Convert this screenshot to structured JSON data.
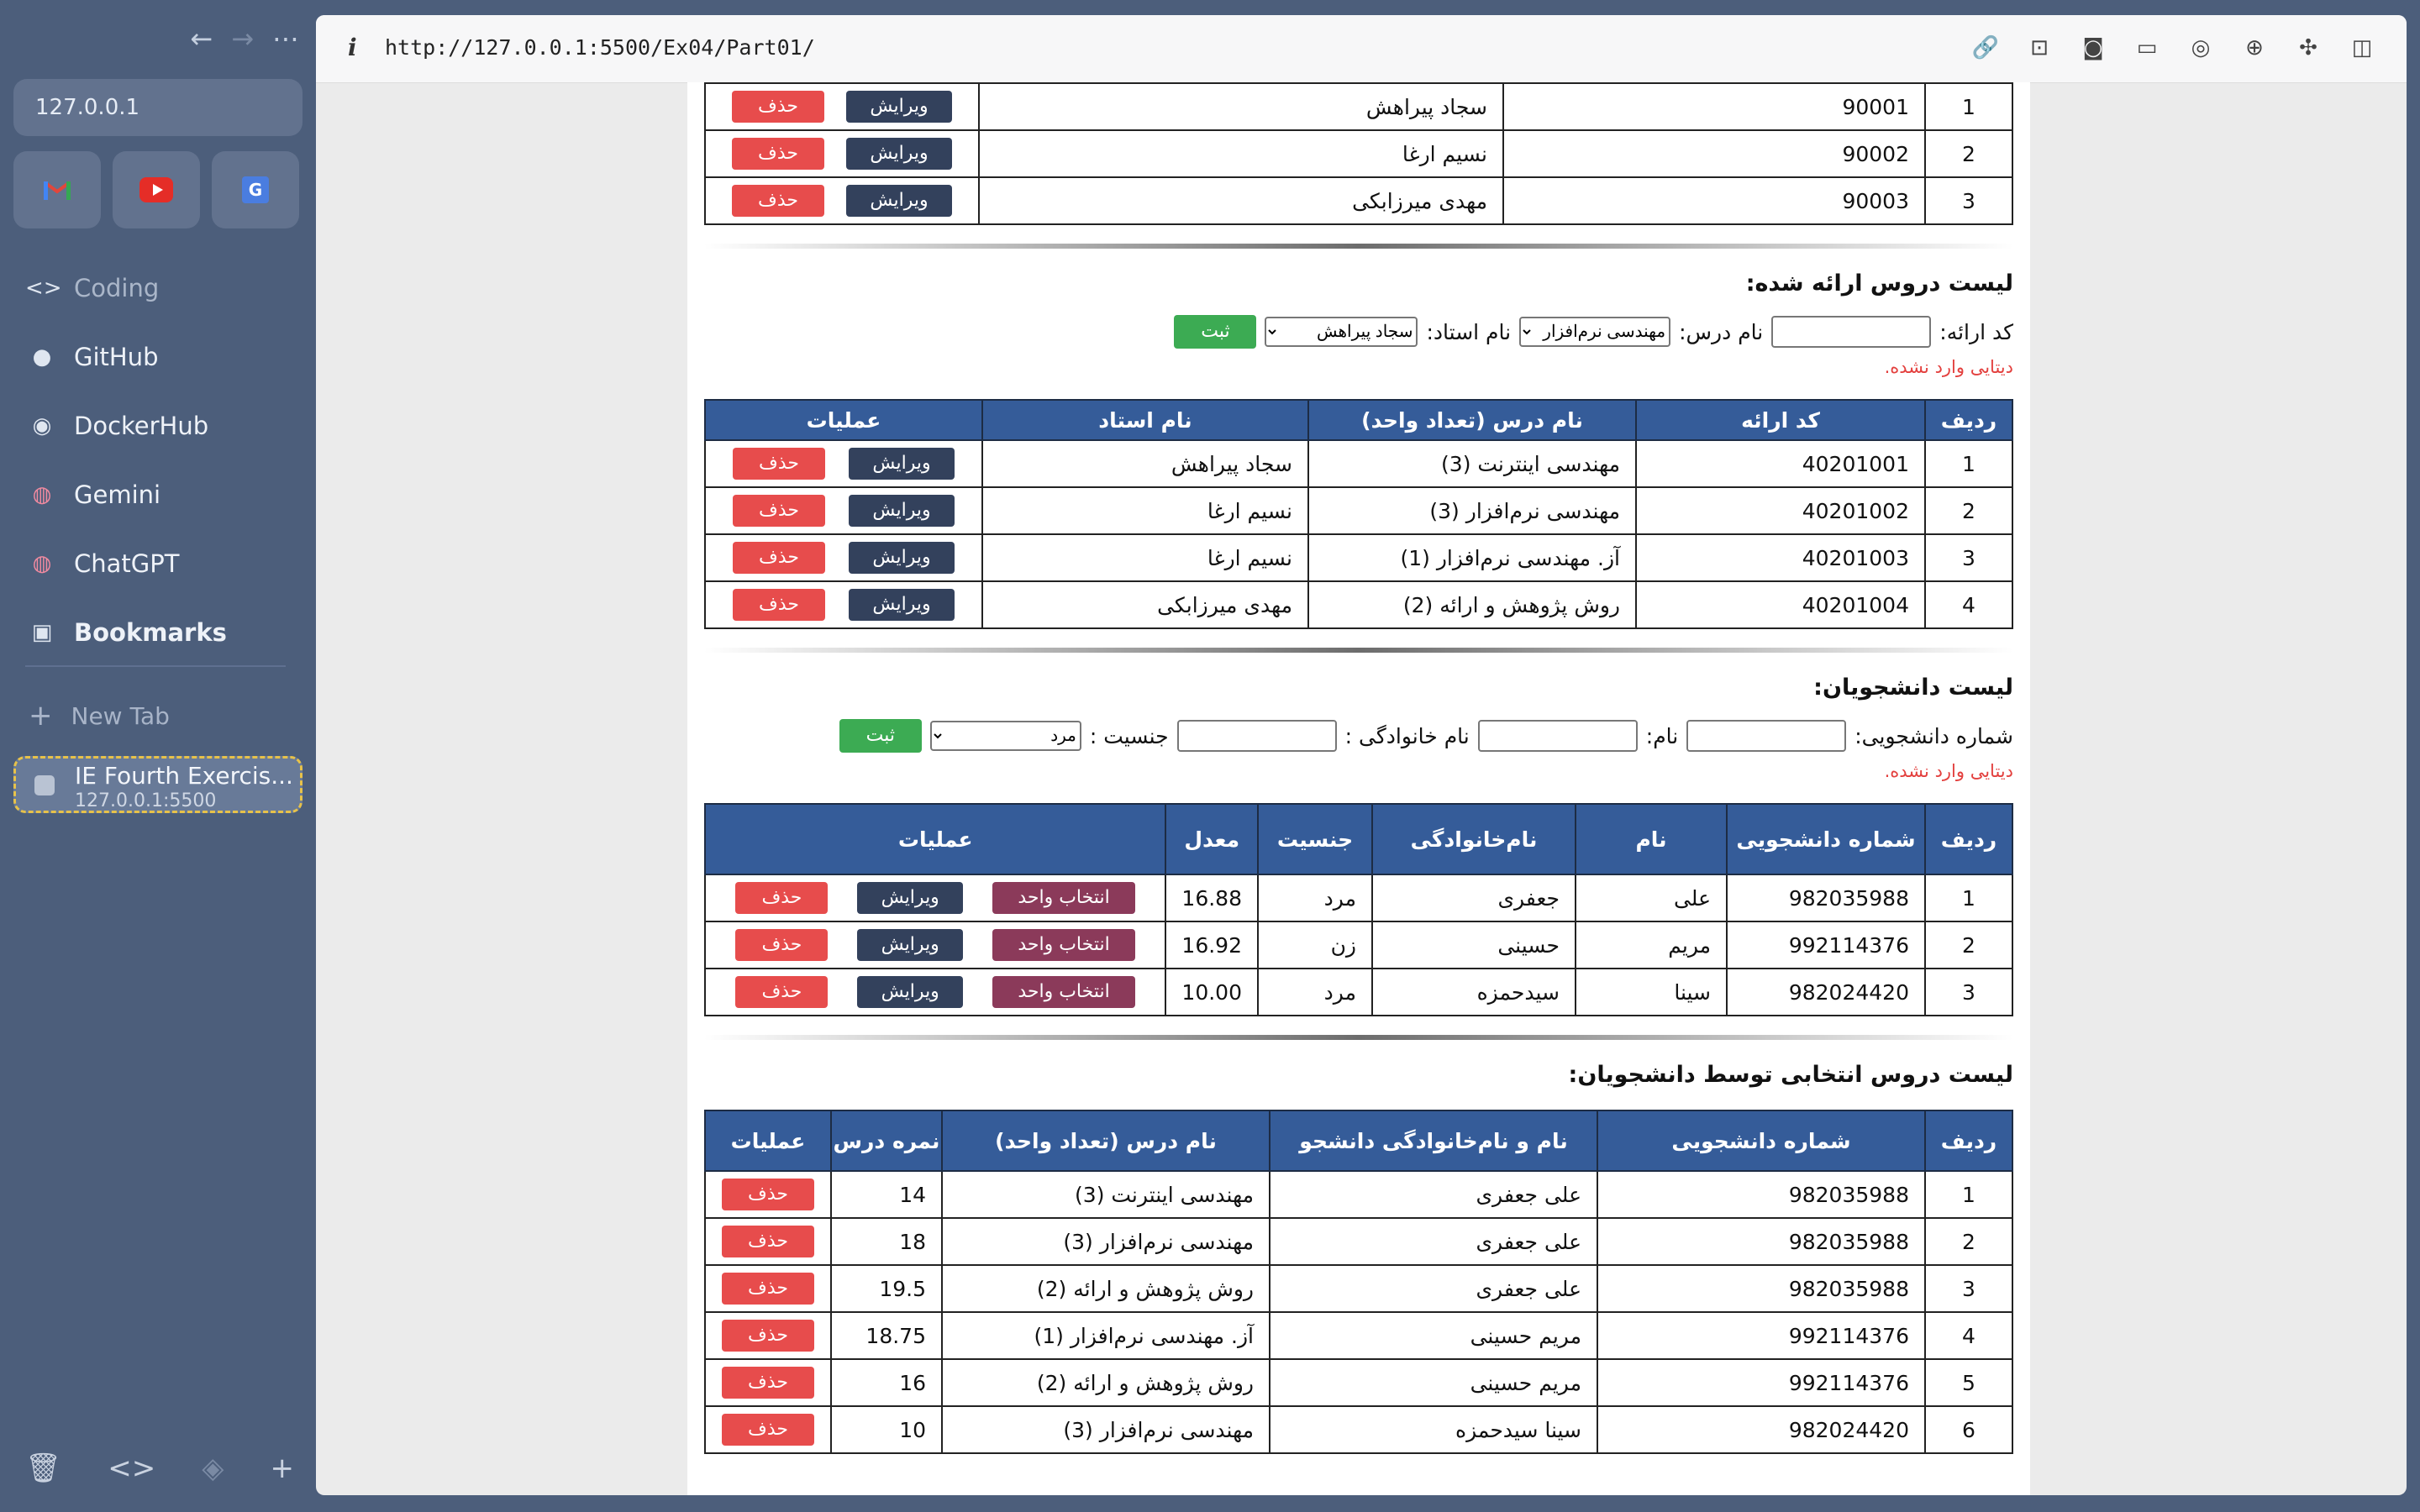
{
  "sidebar": {
    "url_box": "127.0.0.1",
    "items": [
      {
        "label": "Coding",
        "icon": "code-icon"
      },
      {
        "label": "GitHub",
        "icon": "github-icon"
      },
      {
        "label": "DockerHub",
        "icon": "docker-icon"
      },
      {
        "label": "Gemini",
        "icon": "brain-icon"
      },
      {
        "label": "ChatGPT",
        "icon": "brain-icon"
      },
      {
        "label": "Bookmarks",
        "icon": "folder-icon"
      }
    ],
    "new_tab": "New Tab",
    "active_tab": {
      "title": "IE Fourth Exercis...",
      "subtitle": "127.0.0.1:5500"
    }
  },
  "browser": {
    "url": "http://127.0.0.1:5500/Ex04/Part01/"
  },
  "buttons": {
    "delete": "حذف",
    "edit": "ویرایش",
    "pick": "انتخاب واحد",
    "save": "ثبت"
  },
  "professors_table": {
    "rows": [
      {
        "idx": "1",
        "code": "90001",
        "name": "سجاد پیراهش"
      },
      {
        "idx": "2",
        "code": "90002",
        "name": "نسیم ارغا"
      },
      {
        "idx": "3",
        "code": "90003",
        "name": "مهدی میرزابکی"
      }
    ]
  },
  "offered": {
    "title": "لیست دروس ارائه شده:",
    "form": {
      "code_label": "کد ارائه:",
      "course_label": "نام درس:",
      "course_value": "مهندسی نرم‌افزار",
      "prof_label": "نام استاد:",
      "prof_value": "سجاد پیراهش"
    },
    "error": "دیتایی وارد نشده.",
    "headers": {
      "idx": "ردیف",
      "code": "کد ارائه",
      "course": "نام درس (تعداد واحد)",
      "prof": "نام استاد",
      "ops": "عملیات"
    },
    "rows": [
      {
        "idx": "1",
        "code": "40201001",
        "course": "مهندسی اینترنت (3)",
        "prof": "سجاد پیراهش"
      },
      {
        "idx": "2",
        "code": "40201002",
        "course": "مهندسی نرم‌افزار (3)",
        "prof": "نسیم ارغا"
      },
      {
        "idx": "3",
        "code": "40201003",
        "course": "آز. مهندسی نرم‌افزار (1)",
        "prof": "نسیم ارغا"
      },
      {
        "idx": "4",
        "code": "40201004",
        "course": "روش پژوهش و ارائه (2)",
        "prof": "مهدی میرزابکی"
      }
    ]
  },
  "students": {
    "title": "لیست دانشجویان:",
    "form": {
      "id_label": "شماره دانشجویی:",
      "first_label": "نام:",
      "last_label": "نام خانوادگی :",
      "gender_label": "جنسیت :",
      "gender_value": "مرد"
    },
    "error": "دیتایی وارد نشده.",
    "headers": {
      "idx": "ردیف",
      "sid": "شماره دانشجویی",
      "first": "نام",
      "last": "نام‌خانوادگی",
      "gender": "جنسیت",
      "gpa": "معدل",
      "ops": "عملیات"
    },
    "rows": [
      {
        "idx": "1",
        "sid": "982035988",
        "first": "علی",
        "last": "جعفری",
        "gender": "مرد",
        "gpa": "16.88"
      },
      {
        "idx": "2",
        "sid": "992114376",
        "first": "مریم",
        "last": "حسینی",
        "gender": "زن",
        "gpa": "16.92"
      },
      {
        "idx": "3",
        "sid": "982024420",
        "first": "سینا",
        "last": "سیدحمزه",
        "gender": "مرد",
        "gpa": "10.00"
      }
    ]
  },
  "selected": {
    "title": "لیست دروس انتخابی توسط دانشجویان:",
    "headers": {
      "idx": "ردیف",
      "sid": "شماره دانشجویی",
      "name": "نام و نام‌خانوادگی دانشجو",
      "course": "نام درس (تعداد واحد)",
      "grade": "نمره درس",
      "ops": "عملیات"
    },
    "rows": [
      {
        "idx": "1",
        "sid": "982035988",
        "name": "علی جعفری",
        "course": "مهندسی اینترنت (3)",
        "grade": "14"
      },
      {
        "idx": "2",
        "sid": "982035988",
        "name": "علی جعفری",
        "course": "مهندسی نرم‌افزار (3)",
        "grade": "18"
      },
      {
        "idx": "3",
        "sid": "982035988",
        "name": "علی جعفری",
        "course": "روش پژوهش و ارائه (2)",
        "grade": "19.5"
      },
      {
        "idx": "4",
        "sid": "992114376",
        "name": "مریم حسینی",
        "course": "آز. مهندسی نرم‌افزار (1)",
        "grade": "18.75"
      },
      {
        "idx": "5",
        "sid": "992114376",
        "name": "مریم حسینی",
        "course": "روش پژوهش و ارائه (2)",
        "grade": "16"
      },
      {
        "idx": "6",
        "sid": "982024420",
        "name": "سینا سیدحمزه",
        "course": "مهندسی نرم‌افزار (3)",
        "grade": "10"
      }
    ]
  }
}
